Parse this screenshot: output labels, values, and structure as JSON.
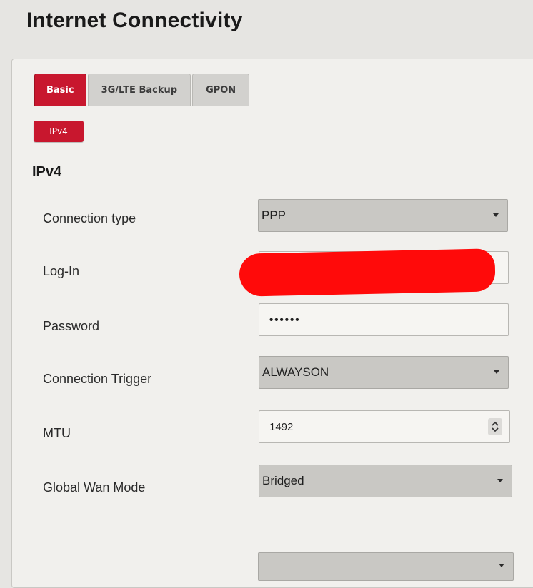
{
  "page": {
    "title": "Internet Connectivity"
  },
  "tabs": [
    {
      "label": "Basic",
      "active": true
    },
    {
      "label": "3G/LTE Backup",
      "active": false
    },
    {
      "label": "GPON",
      "active": false
    }
  ],
  "subtabs": [
    {
      "label": "IPv4",
      "active": true
    }
  ],
  "section": {
    "title": "IPv4"
  },
  "fields": {
    "connection_type": {
      "label": "Connection type",
      "value": "PPP",
      "icon": "chevron-down-icon"
    },
    "login": {
      "label": "Log-In",
      "value": ""
    },
    "password": {
      "label": "Password",
      "value": "••••••"
    },
    "connection_trigger": {
      "label": "Connection Trigger",
      "value": "ALWAYSON",
      "icon": "chevron-down-icon"
    },
    "mtu": {
      "label": "MTU",
      "value": "1492",
      "icon": "stepper-icon"
    },
    "global_wan_mode": {
      "label": "Global Wan Mode",
      "value": "Bridged",
      "icon": "chevron-down-icon"
    }
  },
  "colors": {
    "accent": "#c8172e",
    "redaction": "#ff0a0a"
  }
}
